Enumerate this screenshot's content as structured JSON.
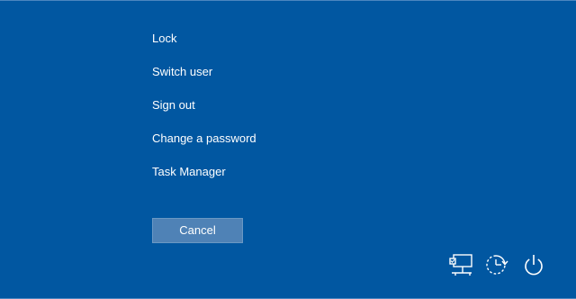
{
  "menu": {
    "items": [
      {
        "label": "Lock"
      },
      {
        "label": "Switch user"
      },
      {
        "label": "Sign out"
      },
      {
        "label": "Change a password"
      },
      {
        "label": "Task Manager"
      }
    ]
  },
  "cancel_label": "Cancel",
  "tray_icons": [
    {
      "icon": "network-icon"
    },
    {
      "icon": "ease-of-access-icon"
    },
    {
      "icon": "power-icon"
    }
  ],
  "colors": {
    "background": "#0157a1",
    "button": "#4f82b6",
    "text": "#ffffff"
  }
}
